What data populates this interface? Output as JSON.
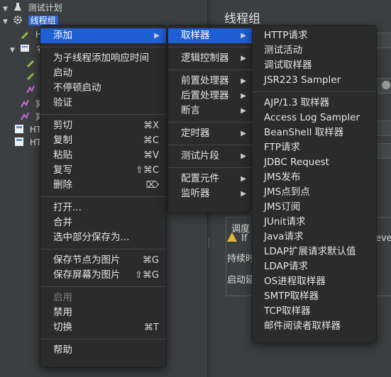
{
  "tree": {
    "items": [
      {
        "label": "测试计划",
        "icon": "flask-icon"
      },
      {
        "label": "线程组",
        "icon": "gear-icon"
      },
      {
        "label": "H",
        "icon": "sampler-icon"
      },
      {
        "label": "彳",
        "icon": "controller-icon"
      },
      {
        "label": "",
        "icon": "sampler-icon"
      },
      {
        "label": "",
        "icon": "sampler-icon"
      },
      {
        "label": "",
        "icon": "listener-icon"
      },
      {
        "label": "冥",
        "icon": "listener-icon"
      },
      {
        "label": "冥",
        "icon": "listener-icon"
      },
      {
        "label": "HT",
        "icon": "config-icon"
      },
      {
        "label": "HT",
        "icon": "config-icon"
      }
    ]
  },
  "right_panel": {
    "title": "线程组",
    "fragments": {
      "warn_text": "If",
      "overflow_text": "ever",
      "duration": "持续时",
      "startup": "启动延",
      "schedule": "调度",
      "small": "调"
    }
  },
  "context_menu": {
    "items": [
      {
        "label": "添加",
        "submenu": true,
        "active": true
      },
      {
        "sep": true
      },
      {
        "label": "为子线程添加响应时间"
      },
      {
        "label": "启动"
      },
      {
        "label": "不停顿启动"
      },
      {
        "label": "验证"
      },
      {
        "sep": true
      },
      {
        "label": "剪切",
        "shortcut": "⌘X"
      },
      {
        "label": "复制",
        "shortcut": "⌘C"
      },
      {
        "label": "粘贴",
        "shortcut": "⌘V"
      },
      {
        "label": "复写",
        "shortcut": "⇧⌘C"
      },
      {
        "label": "删除",
        "shortcut": "⌦"
      },
      {
        "sep": true
      },
      {
        "label": "打开..."
      },
      {
        "label": "合并"
      },
      {
        "label": "选中部分保存为..."
      },
      {
        "sep": true
      },
      {
        "label": "保存节点为图片",
        "shortcut": "⌘G"
      },
      {
        "label": "保存屏幕为图片",
        "shortcut": "⇧⌘G"
      },
      {
        "sep": true
      },
      {
        "label": "启用",
        "disabled": true
      },
      {
        "label": "禁用"
      },
      {
        "label": "切换",
        "shortcut": "⌘T"
      },
      {
        "sep": true
      },
      {
        "label": "帮助"
      }
    ]
  },
  "add_menu": {
    "items": [
      {
        "label": "取样器",
        "submenu": true,
        "active": true
      },
      {
        "sep": true
      },
      {
        "label": "逻辑控制器",
        "submenu": true
      },
      {
        "sep": true
      },
      {
        "label": "前置处理器",
        "submenu": true
      },
      {
        "label": "后置处理器",
        "submenu": true
      },
      {
        "label": "断言",
        "submenu": true
      },
      {
        "sep": true
      },
      {
        "label": "定时器",
        "submenu": true
      },
      {
        "sep": true
      },
      {
        "label": "测试片段",
        "submenu": true
      },
      {
        "sep": true
      },
      {
        "label": "配置元件",
        "submenu": true
      },
      {
        "label": "监听器",
        "submenu": true
      }
    ]
  },
  "sampler_menu": {
    "items": [
      {
        "label": "HTTP请求"
      },
      {
        "label": "测试活动"
      },
      {
        "label": "调试取样器"
      },
      {
        "label": "JSR223 Sampler"
      },
      {
        "sep": true
      },
      {
        "label": "AJP/1.3 取样器"
      },
      {
        "label": "Access Log Sampler"
      },
      {
        "label": "BeanShell 取样器"
      },
      {
        "label": "FTP请求"
      },
      {
        "label": "JDBC Request"
      },
      {
        "label": "JMS发布"
      },
      {
        "label": "JMS点到点"
      },
      {
        "label": "JMS订阅"
      },
      {
        "label": "JUnit请求"
      },
      {
        "label": "Java请求"
      },
      {
        "label": "LDAP扩展请求默认值"
      },
      {
        "label": "LDAP请求"
      },
      {
        "label": "OS进程取样器"
      },
      {
        "label": "SMTP取样器"
      },
      {
        "label": "TCP取样器"
      },
      {
        "label": "邮件阅读者取样器"
      }
    ]
  },
  "colors": {
    "menu_bg": "#2b2b2c",
    "highlight": "#1f5fd6",
    "panel_bg": "#3c3f41"
  }
}
